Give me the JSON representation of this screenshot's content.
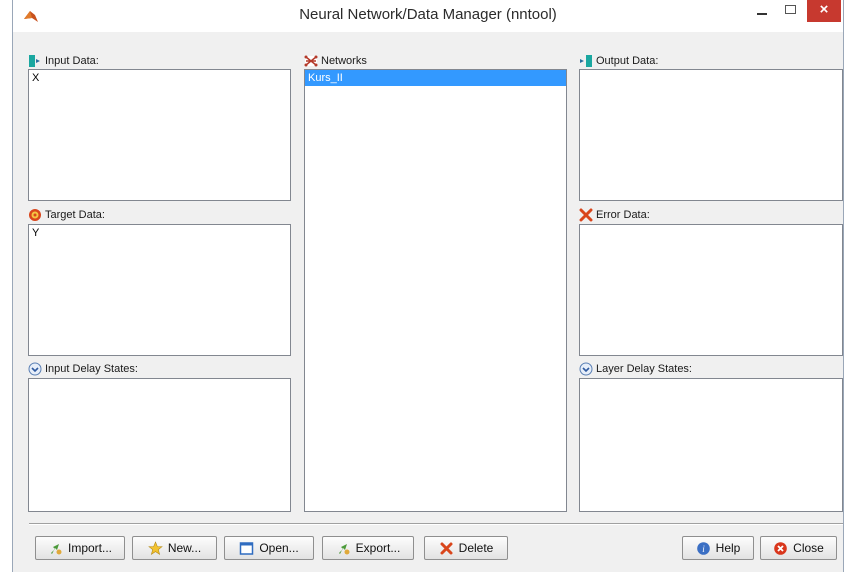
{
  "window": {
    "title": "Neural Network/Data Manager (nntool)",
    "close_glyph": "×"
  },
  "input_data": {
    "label": "Input Data:",
    "items": [
      "X"
    ]
  },
  "target_data": {
    "label": "Target Data:",
    "items": [
      "Y"
    ]
  },
  "input_delay_states": {
    "label": "Input Delay States:",
    "items": []
  },
  "networks": {
    "label": "Networks",
    "items": [
      "Kurs_II"
    ],
    "selected_index": 0
  },
  "output_data": {
    "label": "Output Data:",
    "items": []
  },
  "error_data": {
    "label": "Error Data:",
    "items": []
  },
  "layer_delay_states": {
    "label": "Layer Delay States:",
    "items": []
  },
  "buttons": {
    "import": "Import...",
    "new": "New...",
    "open": "Open...",
    "export": "Export...",
    "delete": "Delete",
    "help": "Help",
    "close": "Close"
  },
  "colors": {
    "selection": "#3399ff",
    "close_button": "#c7392f"
  }
}
